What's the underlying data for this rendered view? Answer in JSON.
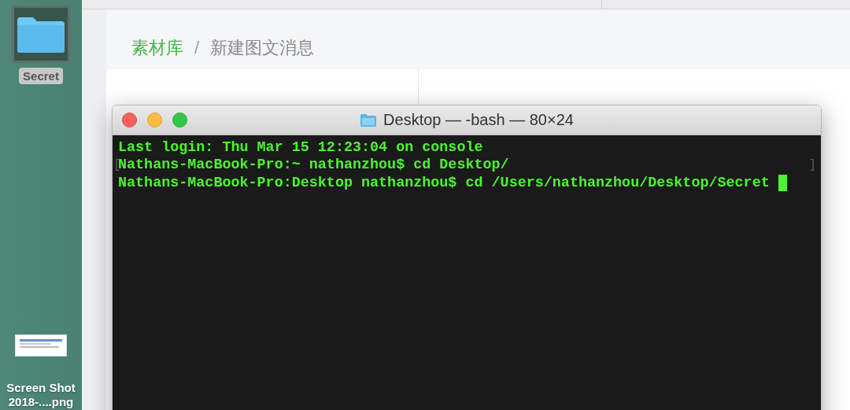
{
  "desktop": {
    "icons": [
      {
        "kind": "folder",
        "label": "Secret",
        "selected": true
      },
      {
        "kind": "screenshot",
        "label": "Screen Shot 2018-....png",
        "selected": false
      }
    ]
  },
  "page": {
    "breadcrumb": [
      {
        "label": "素材库",
        "current": false
      },
      {
        "label": "新建图文消息",
        "current": true
      }
    ],
    "separator": "/"
  },
  "terminal": {
    "title": "Desktop — -bash — 80×24",
    "lines": [
      {
        "kind": "plain",
        "text": "Last login: Thu Mar 15 12:23:04 on console"
      },
      {
        "kind": "marked",
        "text": "Nathans-MacBook-Pro:~ nathanzhou$ cd Desktop/",
        "mark_left": "[",
        "mark_right": "]"
      },
      {
        "kind": "input",
        "text": "Nathans-MacBook-Pro:Desktop nathanzhou$ cd /Users/nathanzhou/Desktop/Secret "
      }
    ]
  }
}
